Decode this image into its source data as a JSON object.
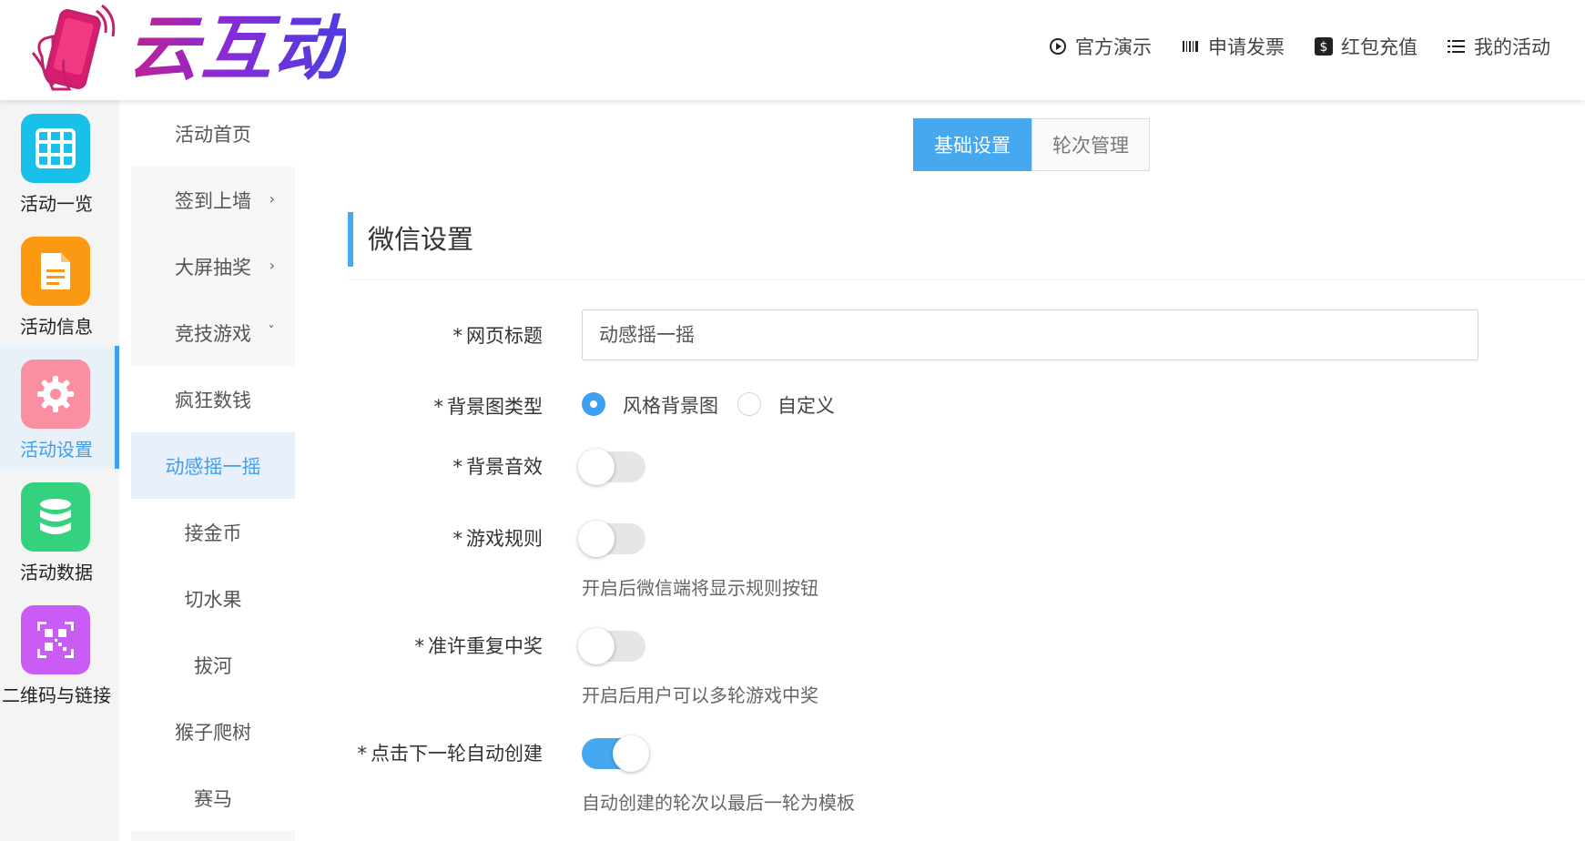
{
  "brand": {
    "name": "云互动"
  },
  "topnav": [
    {
      "label": "官方演示",
      "icon": "play-circle-icon"
    },
    {
      "label": "申请发票",
      "icon": "barcode-icon"
    },
    {
      "label": "红包充值",
      "icon": "dollar-icon"
    },
    {
      "label": "我的活动",
      "icon": "list-icon"
    }
  ],
  "sidebar": {
    "items": [
      {
        "label": "活动一览",
        "icon": "grid-icon",
        "color": "#19c1ea"
      },
      {
        "label": "活动信息",
        "icon": "document-icon",
        "color": "#fb9a12"
      },
      {
        "label": "活动设置",
        "icon": "gear-icon",
        "color": "#f98fa0",
        "active": true
      },
      {
        "label": "活动数据",
        "icon": "database-icon",
        "color": "#34d27f"
      },
      {
        "label": "二维码与链接",
        "icon": "qrcode-icon",
        "color": "#c95cf4"
      }
    ]
  },
  "submenu": {
    "items": [
      {
        "label": "活动首页"
      },
      {
        "label": "签到上墙",
        "chevron": "›"
      },
      {
        "label": "大屏抽奖",
        "chevron": "›"
      },
      {
        "label": "竞技游戏",
        "chevron": "ˇ"
      },
      {
        "label": "疯狂数钱"
      },
      {
        "label": "动感摇一摇",
        "active": true
      },
      {
        "label": "接金币"
      },
      {
        "label": "切水果"
      },
      {
        "label": "拔河"
      },
      {
        "label": "猴子爬树"
      },
      {
        "label": "赛马"
      }
    ]
  },
  "tabs": [
    {
      "label": "基础设置",
      "active": true
    },
    {
      "label": "轮次管理"
    }
  ],
  "section": {
    "title": "微信设置"
  },
  "form": {
    "page_title": {
      "label": "网页标题",
      "value": "动感摇一摇"
    },
    "bg_type": {
      "label": "背景图类型",
      "options": [
        "风格背景图",
        "自定义"
      ],
      "selected": "风格背景图"
    },
    "bg_sound": {
      "label": "背景音效",
      "on": false
    },
    "game_rules": {
      "label": "游戏规则",
      "on": false,
      "hint": "开启后微信端将显示规则按钮"
    },
    "repeat_win": {
      "label": "准许重复中奖",
      "on": false,
      "hint": "开启后用户可以多轮游戏中奖"
    },
    "auto_create": {
      "label": "点击下一轮自动创建",
      "on": true,
      "hint": "自动创建的轮次以最后一轮为模板"
    }
  },
  "colors": {
    "accent": "#46a8ee"
  }
}
